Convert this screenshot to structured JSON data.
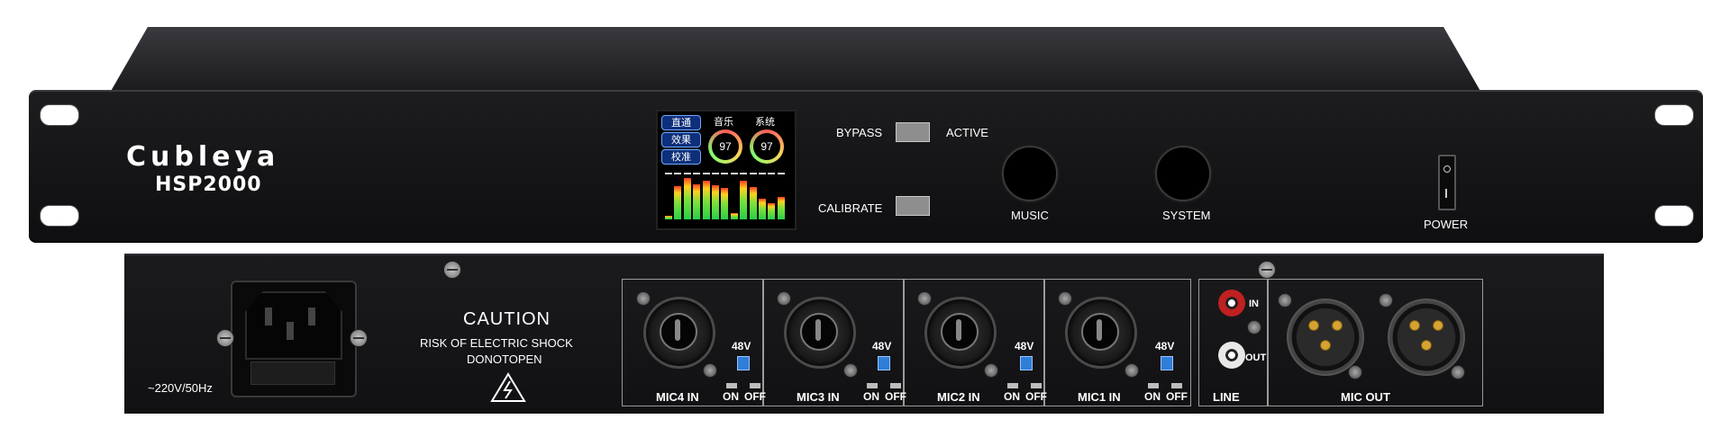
{
  "front_panel": {
    "brand": "Cubleya",
    "model": "HSP2000",
    "screen": {
      "buttons": [
        "直通",
        "效果",
        "校准"
      ],
      "music_label": "音乐",
      "system_label": "系统",
      "music_value": "97",
      "system_value": "97",
      "meter_levels": [
        0.08,
        0.78,
        0.95,
        0.82,
        0.9,
        0.8,
        0.72,
        0.15,
        0.9,
        0.74,
        0.48,
        0.38,
        0.52
      ]
    },
    "bypass_label": "BYPASS",
    "active_label": "ACTIVE",
    "calibrate_label": "CALIBRATE",
    "music_knob_label": "MUSIC",
    "system_knob_label": "SYSTEM",
    "power_label": "POWER"
  },
  "rear_panel": {
    "voltage": "~220V/50Hz",
    "caution_title": "CAUTION",
    "caution_line1": "RISK OF ELECTRIC SHOCK",
    "caution_line2": "DONOTOPEN",
    "phantom_label": "48V",
    "on_label": "ON",
    "off_label": "OFF",
    "mic_inputs": [
      "MIC4 IN",
      "MIC3 IN",
      "MIC2 IN",
      "MIC1 IN"
    ],
    "line_label": "LINE",
    "line_in_label": "IN",
    "line_out_label": "OUT",
    "mic_out_label": "MIC OUT"
  }
}
